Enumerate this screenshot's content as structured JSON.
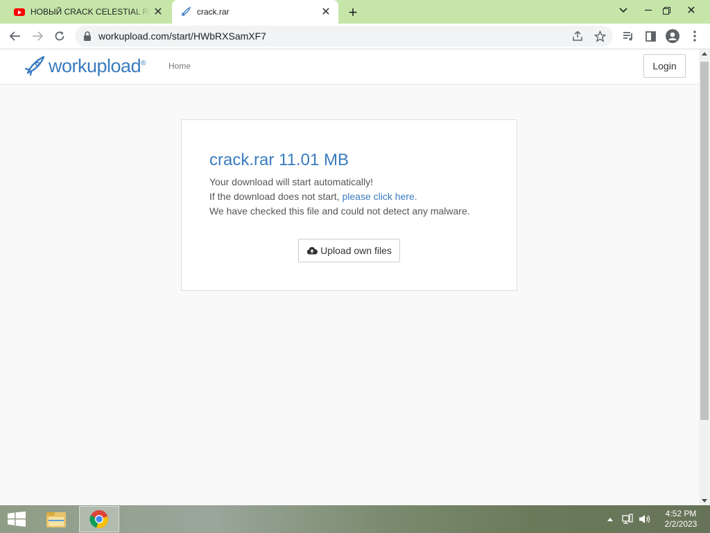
{
  "browser": {
    "tabs": [
      {
        "title": "НОВЫЙ CRACK CELESTIAL RECO",
        "icon": "youtube-icon"
      },
      {
        "title": "crack.rar",
        "icon": "workupload-rocket-icon"
      }
    ],
    "url": "workupload.com/start/HWbRXSamXF7",
    "accent_color": "#c5e6a8"
  },
  "site": {
    "logo_text": "workupload",
    "logo_mark": "®",
    "nav_home": "Home",
    "login_label": "Login",
    "brand_color": "#3a7cc0"
  },
  "main": {
    "file_title": "crack.rar 11.01 MB",
    "message_auto": "Your download will start automatically!",
    "message_fallback_prefix": "If the download does not start, ",
    "message_fallback_link": "please click here.",
    "message_scan": "We have checked this file and could not detect any malware.",
    "upload_label": "Upload own files"
  },
  "taskbar": {
    "time": "4:52 PM",
    "date": "2/2/2023"
  }
}
